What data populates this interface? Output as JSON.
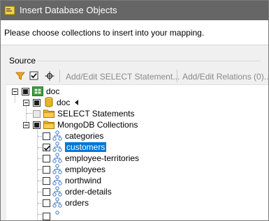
{
  "window": {
    "title": "Insert Database Objects",
    "instructions": "Please choose collections to insert into your mapping."
  },
  "source": {
    "group_label": "Source"
  },
  "toolbar": {
    "filter_icon": "filter-icon",
    "check_icon": "checkmark-icon",
    "crosshair_icon": "crosshair-icon",
    "add_edit_select": "Add/Edit SELECT Statement...",
    "add_edit_relations": "Add/Edit Relations (0)..."
  },
  "tree": {
    "root": {
      "label": "doc",
      "icon": "database-connection-icon",
      "checked": "partial"
    },
    "db": {
      "label": "doc",
      "icon": "database-icon",
      "checked": "partial"
    },
    "select_statements": {
      "label": "SELECT Statements",
      "icon": "folder-icon",
      "checked": "disabled"
    },
    "mongodb": {
      "label": "MongoDB Collections",
      "icon": "folder-icon",
      "checked": "partial"
    },
    "collections": [
      {
        "label": "categories",
        "checked": false,
        "selected": false
      },
      {
        "label": "customers",
        "checked": true,
        "selected": true
      },
      {
        "label": "employee-territories",
        "checked": false,
        "selected": false
      },
      {
        "label": "employees",
        "checked": false,
        "selected": false
      },
      {
        "label": "northwind",
        "checked": false,
        "selected": false
      },
      {
        "label": "order-details",
        "checked": false,
        "selected": false
      },
      {
        "label": "orders",
        "checked": false,
        "selected": false
      }
    ]
  },
  "colors": {
    "titlebar": "#666666",
    "selection": "#0078d7",
    "folder": "#f5b82e",
    "db_cylinder": "#e8b420",
    "root_icon": "#3fae3f"
  }
}
